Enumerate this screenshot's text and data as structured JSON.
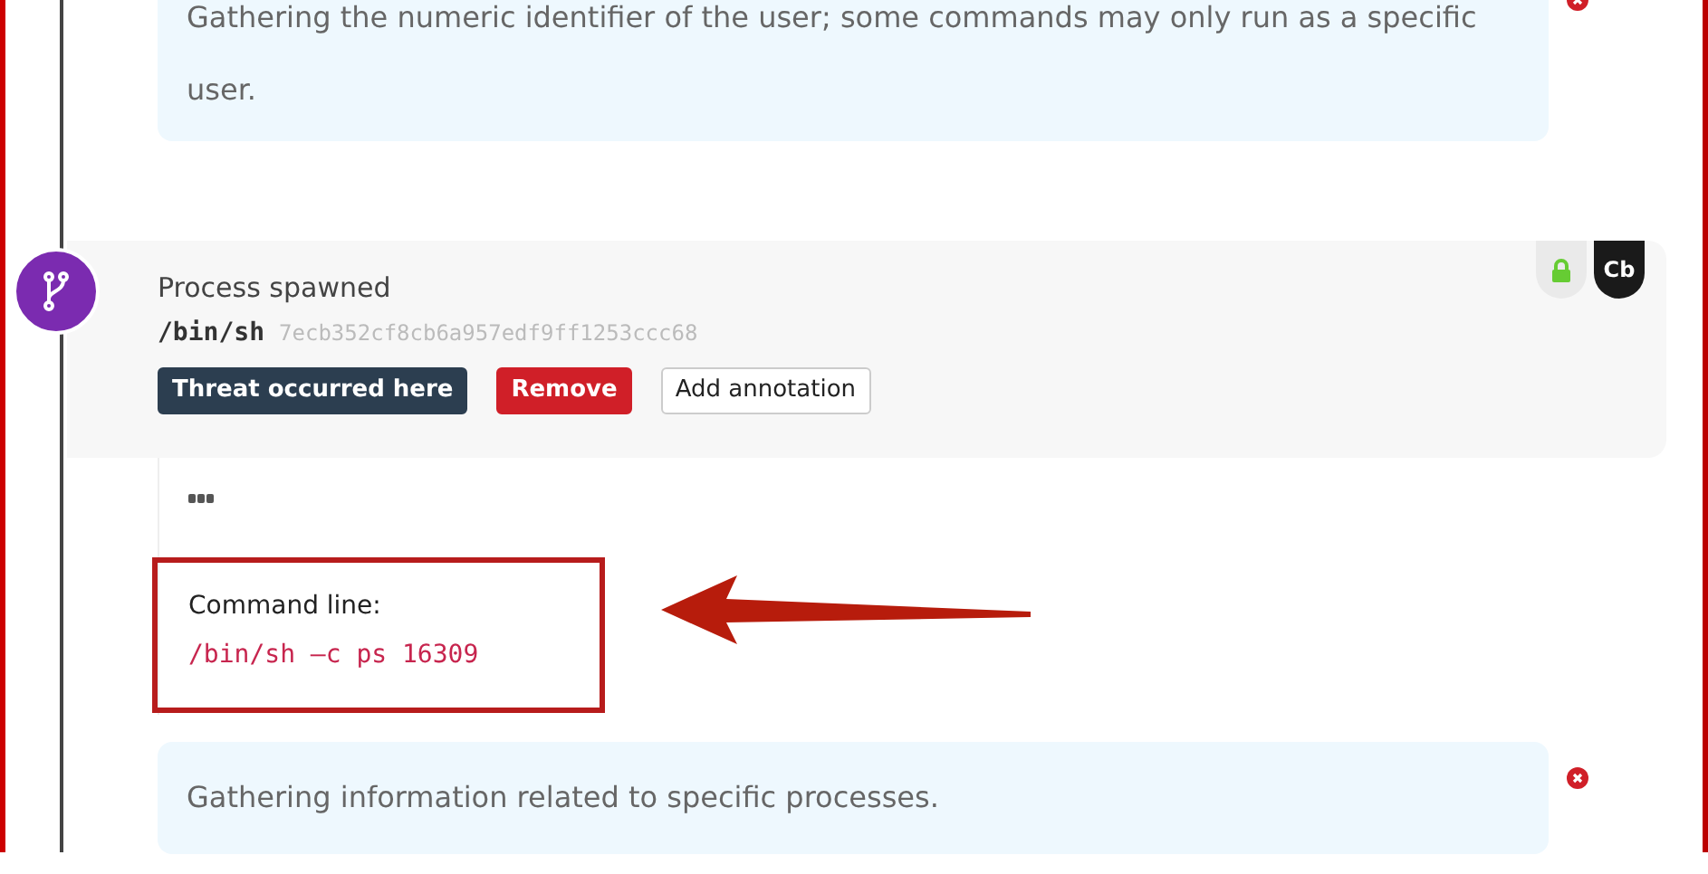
{
  "top_note": {
    "text": "Gathering the numeric identifier of the user; some commands may only run as a specific user."
  },
  "event": {
    "title": "Process spawned",
    "path": "/bin/sh",
    "hash": "7ecb352cf8cb6a957edf9ff1253ccc68",
    "buttons": [
      {
        "label": "Threat occurred here",
        "kind": "dark"
      },
      {
        "label": "Remove",
        "kind": "danger"
      },
      {
        "label": "Add annotation",
        "kind": "outline"
      }
    ],
    "badges": [
      {
        "kind": "lock"
      },
      {
        "kind": "brand",
        "label": "Cb"
      }
    ]
  },
  "details": {
    "field_label": "Command line:",
    "command": "/bin/sh –c ps 16309",
    "highlighted": true
  },
  "bottom_note": {
    "text": "Gathering information related to specific processes."
  }
}
